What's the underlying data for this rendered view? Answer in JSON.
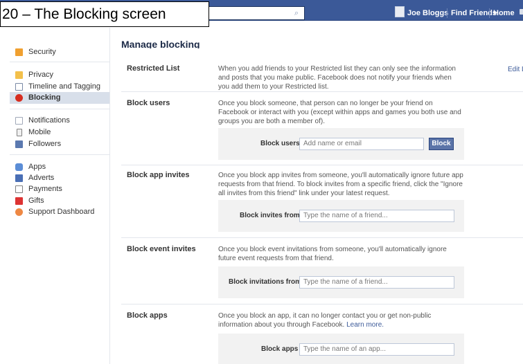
{
  "caption": "20 – The Blocking screen",
  "header": {
    "search_icon": "magnifier-icon",
    "user_name": "Joe Bloggs",
    "find_friends": "Find Friends",
    "home": "Home"
  },
  "sidebar": {
    "items": [
      {
        "label": "Security",
        "icon": "padlock-icon"
      },
      {
        "label": "Privacy",
        "icon": "lock-icon"
      },
      {
        "label": "Timeline and Tagging",
        "icon": "timeline-icon"
      },
      {
        "label": "Blocking",
        "icon": "blocking-icon",
        "selected": true
      },
      {
        "label": "Notifications",
        "icon": "notifications-icon"
      },
      {
        "label": "Mobile",
        "icon": "mobile-icon"
      },
      {
        "label": "Followers",
        "icon": "followers-icon"
      },
      {
        "label": "Apps",
        "icon": "apps-icon"
      },
      {
        "label": "Adverts",
        "icon": "adverts-icon"
      },
      {
        "label": "Payments",
        "icon": "payments-icon"
      },
      {
        "label": "Gifts",
        "icon": "gifts-icon"
      },
      {
        "label": "Support Dashboard",
        "icon": "support-icon"
      }
    ]
  },
  "main": {
    "title": "Manage blocking",
    "restricted": {
      "label": "Restricted List",
      "desc": "When you add friends to your Restricted list they can only see the information and posts that you make public. Facebook does not notify your friends when you add them to your Restricted list.",
      "edit": "Edit List"
    },
    "block_users": {
      "label": "Block users",
      "desc": "Once you block someone, that person can no longer be your friend on Facebook or interact with you (except within apps and games you both use and groups you are both a member of).",
      "field_label": "Block users",
      "placeholder": "Add name or email",
      "button": "Block"
    },
    "block_app_invites": {
      "label": "Block app invites",
      "desc": "Once you block app invites from someone, you'll automatically ignore future app requests from that friend. To block invites from a specific friend, click the \"Ignore all invites from this friend\" link under your latest request.",
      "field_label": "Block invites from",
      "placeholder": "Type the name of a friend..."
    },
    "block_event_invites": {
      "label": "Block event invites",
      "desc": "Once you block event invitations from someone, you'll automatically ignore future event requests from that friend.",
      "field_label": "Block invitations from",
      "placeholder": "Type the name of a friend..."
    },
    "block_apps": {
      "label": "Block apps",
      "desc": "Once you block an app, it can no longer contact you or get non-public information about you through Facebook.",
      "learn_more": "Learn more.",
      "field_label": "Block apps",
      "placeholder": "Type the name of an app..."
    }
  },
  "colors": {
    "topbar": "#3b5998",
    "link": "#3b5998",
    "panel": "#f2f2f2",
    "selected_nav": "#d8dfea"
  }
}
